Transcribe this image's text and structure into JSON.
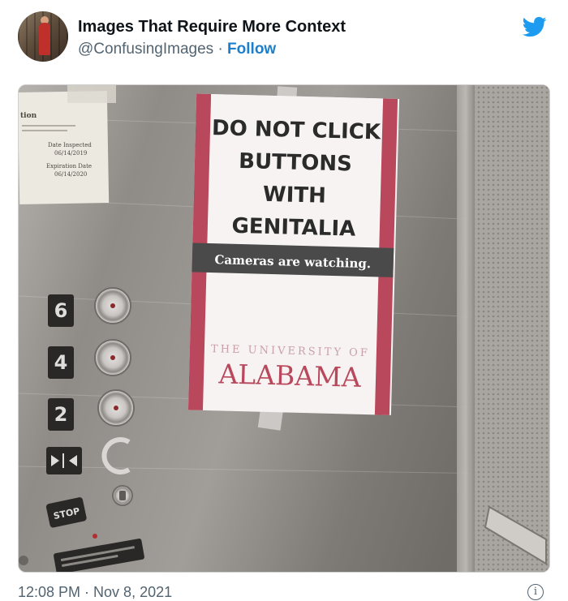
{
  "tweet": {
    "author_name": "Images That Require More Context",
    "handle": "@ConfusingImages",
    "separator": "·",
    "follow_label": "Follow",
    "timestamp": "12:08 PM · Nov 8, 2021",
    "info_glyph": "i"
  },
  "photo": {
    "sign": {
      "line1": "DO NOT CLICK",
      "line2": "BUTTONS",
      "line3": "WITH",
      "line4": "GENITALIA",
      "banner": "Cameras are watching.",
      "university_prefix": "THE UNIVERSITY OF",
      "university_name": "ALABAMA"
    },
    "floor_buttons": [
      "6",
      "4",
      "2"
    ],
    "stop_label": "STOP"
  },
  "colors": {
    "brand_blue": "#1d9bf0",
    "follow_blue": "#1d7fcb",
    "crimson": "#9e1b32",
    "steel": "#8e8a86"
  },
  "icons": {
    "twitter": "twitter-bird-icon",
    "info": "info-icon"
  }
}
